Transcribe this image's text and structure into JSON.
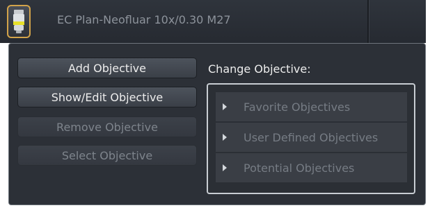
{
  "header": {
    "objective_name": "EC Plan-Neofluar 10x/0.30 M27",
    "objective_icon": "objective-lens-icon"
  },
  "panel": {
    "buttons": [
      {
        "label": "Add Objective",
        "state": "enabled"
      },
      {
        "label": "Show/Edit Objective",
        "state": "enabled"
      },
      {
        "label": "Remove Objective",
        "state": "disabled"
      },
      {
        "label": "Select Objective",
        "state": "disabled"
      }
    ],
    "change_label": "Change Objective:",
    "categories": [
      {
        "label": "Favorite Objectives",
        "icon": "expand-arrow-icon"
      },
      {
        "label": "User Defined Objectives",
        "icon": "expand-arrow-icon"
      },
      {
        "label": "Potential Objectives",
        "icon": "expand-arrow-icon"
      }
    ]
  },
  "colors": {
    "accent": "#d2a34a",
    "lens_band": "#e8e12a",
    "background": "#2c3037"
  }
}
